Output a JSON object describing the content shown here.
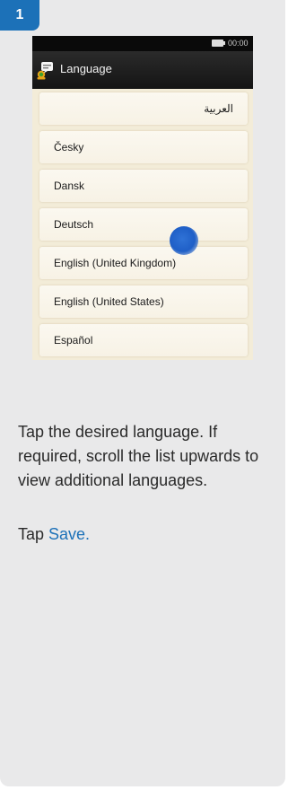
{
  "step": {
    "number": "1"
  },
  "phone": {
    "status_bar": {
      "clock": "00:00"
    },
    "title": "Language",
    "languages": [
      {
        "label": "العربية"
      },
      {
        "label": "Česky"
      },
      {
        "label": "Dansk"
      },
      {
        "label": "Deutsch"
      },
      {
        "label": "English (United Kingdom)"
      },
      {
        "label": "English (United States)"
      },
      {
        "label": "Español"
      }
    ],
    "selected_language": "Deutsch"
  },
  "instructions": {
    "text": "Tap the desired language. If required, scroll the list upwards to view additional languages.",
    "tap_prefix": "Tap ",
    "save_link": "Save."
  },
  "colors": {
    "accent": "#1c71b8",
    "card_bg": "#e9e9ea",
    "screen_bg": "#f3ecd8",
    "touch_indicator": "#1f5fc7"
  },
  "icons": {
    "title": "language-flag-icon",
    "battery": "battery-icon",
    "touch": "touch-indicator-icon"
  }
}
